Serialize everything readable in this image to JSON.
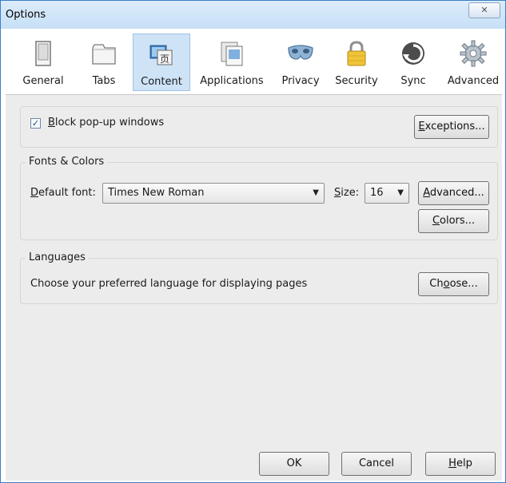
{
  "window": {
    "title": "Options",
    "close_glyph": "✕"
  },
  "toolbar": {
    "items": [
      {
        "label": "General",
        "icon": "general-icon",
        "selected": false
      },
      {
        "label": "Tabs",
        "icon": "tabs-icon",
        "selected": false
      },
      {
        "label": "Content",
        "icon": "content-icon",
        "selected": true
      },
      {
        "label": "Applications",
        "icon": "applications-icon",
        "selected": false
      },
      {
        "label": "Privacy",
        "icon": "privacy-mask-icon",
        "selected": false
      },
      {
        "label": "Security",
        "icon": "padlock-icon",
        "selected": false
      },
      {
        "label": "Sync",
        "icon": "sync-icon",
        "selected": false
      },
      {
        "label": "Advanced",
        "icon": "gear-icon",
        "selected": false
      }
    ]
  },
  "popup": {
    "checkbox_checked": true,
    "label_pre": "",
    "label_u": "B",
    "label_post": "lock pop-up windows",
    "exceptions_u": "E",
    "exceptions_post": "xceptions..."
  },
  "fonts": {
    "legend": "Fonts & Colors",
    "default_font_u": "D",
    "default_font_post": "efault font:",
    "font_value": "Times New Roman",
    "size_u": "S",
    "size_post": "ize:",
    "size_value": "16",
    "advanced_u": "A",
    "advanced_post": "dvanced...",
    "colors_u": "C",
    "colors_post": "olors..."
  },
  "languages": {
    "legend": "Languages",
    "description": "Choose your preferred language for displaying pages",
    "choose_pre": "Ch",
    "choose_u": "o",
    "choose_post": "ose..."
  },
  "footer": {
    "ok": "OK",
    "cancel": "Cancel",
    "help_u": "H",
    "help_post": "elp"
  },
  "colors": {
    "titlebar": "#c6dff6",
    "selected_tab": "#cfe3f7",
    "panel": "#ececec"
  }
}
